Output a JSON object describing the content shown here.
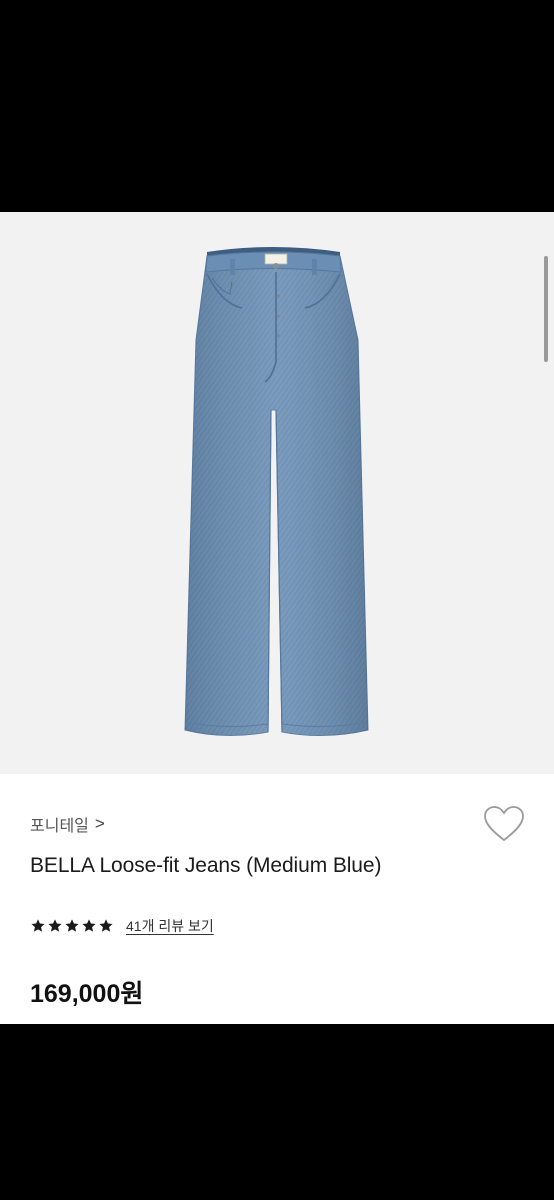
{
  "product": {
    "brand_link": "포니테일",
    "chevron": ">",
    "title": "BELLA Loose-fit Jeans (Medium Blue)",
    "rating_stars": 5,
    "review_link": "41개 리뷰 보기",
    "price": "169,000원"
  },
  "icons": {
    "brand_chevron": "chevron-right-icon",
    "wishlist": "heart-outline-icon",
    "star": "star-filled-icon"
  },
  "colors": {
    "denim": "#6f93b8",
    "image_bg": "#f2f2f3",
    "stars": "#1a1a1a"
  }
}
